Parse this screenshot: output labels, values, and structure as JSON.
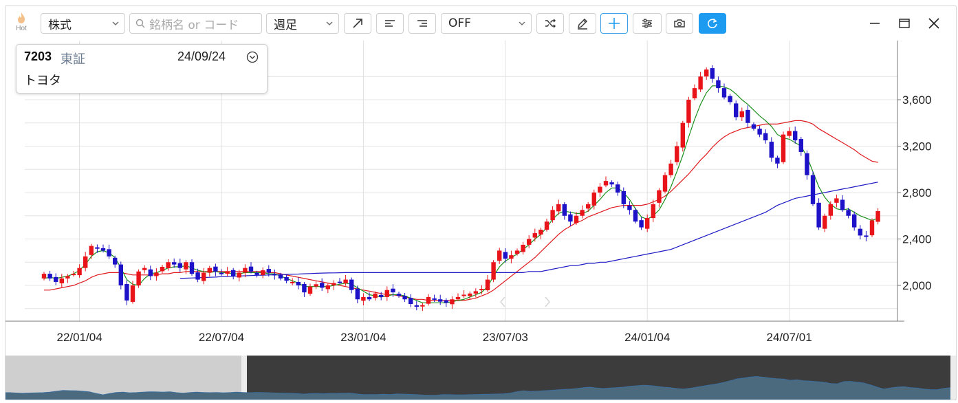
{
  "toolbar": {
    "hot_label": "Hot",
    "asset_type": "株式",
    "search_placeholder": "銘柄名 or コード",
    "period": "週足",
    "indicator": "OFF"
  },
  "info": {
    "code": "7203",
    "market": "東証",
    "date": "24/09/24",
    "name": "トヨタ"
  },
  "colors": {
    "up": "#e8141a",
    "down": "#1d12c8",
    "ma_short": "#1a8f1a",
    "ma_mid": "#e0191e",
    "ma_long": "#1b19c4",
    "accent": "#1d9bf0"
  },
  "chart_data": {
    "type": "candlestick",
    "y_ticks": [
      "2,000",
      "2,400",
      "2,800",
      "3,200",
      "3,600"
    ],
    "y_tick_values": [
      2000,
      2400,
      2800,
      3200,
      3600
    ],
    "x_ticks": [
      "22/01/04",
      "22/07/04",
      "23/01/04",
      "23/07/03",
      "24/01/04",
      "24/07/01"
    ],
    "ylim": [
      1800,
      3900
    ],
    "weeks": 142,
    "close": [
      2100,
      2060,
      2030,
      2060,
      2080,
      2100,
      2150,
      2250,
      2340,
      2320,
      2300,
      2250,
      2180,
      2000,
      1870,
      2000,
      2120,
      2150,
      2080,
      2110,
      2160,
      2200,
      2180,
      2150,
      2200,
      2100,
      2050,
      2110,
      2150,
      2120,
      2100,
      2120,
      2080,
      2110,
      2150,
      2120,
      2090,
      2130,
      2110,
      2090,
      2060,
      2040,
      2030,
      2000,
      1940,
      1990,
      2010,
      1980,
      2000,
      2020,
      2030,
      2050,
      1960,
      1880,
      1900,
      1880,
      1930,
      1900,
      1960,
      1940,
      1910,
      1880,
      1840,
      1820,
      1830,
      1900,
      1880,
      1860,
      1850,
      1880,
      1900,
      1920,
      1930,
      1950,
      1970,
      2050,
      2200,
      2300,
      2230,
      2260,
      2300,
      2350,
      2400,
      2450,
      2480,
      2550,
      2650,
      2700,
      2600,
      2550,
      2600,
      2650,
      2700,
      2800,
      2850,
      2900,
      2870,
      2800,
      2700,
      2650,
      2550,
      2500,
      2580,
      2700,
      2820,
      2950,
      3050,
      3200,
      3400,
      3600,
      3700,
      3800,
      3860,
      3780,
      3700,
      3620,
      3580,
      3450,
      3500,
      3400,
      3350,
      3300,
      3250,
      3100,
      3050,
      3300,
      3330,
      3250,
      3150,
      2950,
      2700,
      2500,
      2600,
      2700,
      2750,
      2650,
      2600,
      2500,
      2430,
      2420,
      2560,
      2640
    ],
    "ma_short": [
      2060,
      2070,
      2060,
      2070,
      2080,
      2100,
      2130,
      2180,
      2250,
      2290,
      2300,
      2280,
      2240,
      2150,
      2050,
      2010,
      2000,
      2060,
      2100,
      2110,
      2130,
      2150,
      2160,
      2160,
      2170,
      2150,
      2130,
      2120,
      2110,
      2120,
      2110,
      2110,
      2100,
      2100,
      2110,
      2110,
      2110,
      2110,
      2100,
      2100,
      2080,
      2060,
      2040,
      2020,
      1990,
      1990,
      1990,
      1990,
      1990,
      2000,
      2010,
      2020,
      2010,
      1980,
      1950,
      1920,
      1910,
      1900,
      1910,
      1920,
      1920,
      1910,
      1890,
      1870,
      1850,
      1850,
      1850,
      1850,
      1850,
      1860,
      1870,
      1880,
      1900,
      1920,
      1940,
      1990,
      2080,
      2160,
      2210,
      2240,
      2270,
      2310,
      2350,
      2400,
      2440,
      2500,
      2570,
      2620,
      2640,
      2630,
      2620,
      2620,
      2640,
      2690,
      2740,
      2800,
      2840,
      2840,
      2800,
      2740,
      2660,
      2590,
      2570,
      2600,
      2650,
      2740,
      2850,
      2980,
      3120,
      3280,
      3430,
      3560,
      3660,
      3720,
      3720,
      3710,
      3690,
      3650,
      3600,
      3560,
      3510,
      3460,
      3420,
      3370,
      3300,
      3270,
      3260,
      3230,
      3200,
      3110,
      2980,
      2850,
      2760,
      2700,
      2660,
      2650,
      2660,
      2630,
      2600,
      2580,
      2560,
      2580
    ],
    "ma_mid": [
      1960,
      1960,
      1970,
      1980,
      1990,
      2000,
      2020,
      2040,
      2070,
      2090,
      2100,
      2110,
      2110,
      2110,
      2100,
      2090,
      2090,
      2090,
      2090,
      2090,
      2100,
      2100,
      2110,
      2110,
      2120,
      2120,
      2120,
      2120,
      2120,
      2120,
      2120,
      2120,
      2120,
      2120,
      2120,
      2120,
      2120,
      2120,
      2110,
      2110,
      2100,
      2090,
      2080,
      2070,
      2060,
      2050,
      2040,
      2030,
      2020,
      2010,
      2000,
      1990,
      1980,
      1970,
      1960,
      1950,
      1940,
      1930,
      1920,
      1920,
      1910,
      1900,
      1890,
      1880,
      1880,
      1870,
      1870,
      1870,
      1870,
      1870,
      1870,
      1870,
      1880,
      1890,
      1910,
      1930,
      1960,
      2000,
      2040,
      2080,
      2120,
      2160,
      2200,
      2240,
      2290,
      2340,
      2390,
      2440,
      2480,
      2510,
      2540,
      2560,
      2590,
      2610,
      2630,
      2650,
      2670,
      2680,
      2690,
      2690,
      2690,
      2690,
      2700,
      2720,
      2740,
      2770,
      2810,
      2860,
      2910,
      2960,
      3020,
      3080,
      3130,
      3190,
      3240,
      3280,
      3310,
      3330,
      3350,
      3360,
      3370,
      3380,
      3390,
      3390,
      3390,
      3400,
      3410,
      3420,
      3420,
      3410,
      3390,
      3350,
      3320,
      3290,
      3260,
      3230,
      3200,
      3170,
      3130,
      3100,
      3070,
      3060
    ],
    "ma_long_start": 23,
    "ma_long": [
      2060,
      2062,
      2064,
      2066,
      2068,
      2070,
      2072,
      2075,
      2077,
      2079,
      2081,
      2083,
      2085,
      2087,
      2088,
      2090,
      2091,
      2093,
      2095,
      2097,
      2098,
      2100,
      2102,
      2104,
      2106,
      2107,
      2108,
      2109,
      2110,
      2110,
      2110,
      2110,
      2110,
      2110,
      2110,
      2110,
      2110,
      2110,
      2110,
      2110,
      2110,
      2110,
      2110,
      2110,
      2110,
      2110,
      2110,
      2110,
      2110,
      2110,
      2110,
      2110,
      2110,
      2110,
      2110,
      2110,
      2110,
      2110,
      2110,
      2120,
      2120,
      2120,
      2130,
      2140,
      2150,
      2160,
      2170,
      2170,
      2180,
      2190,
      2190,
      2200,
      2200,
      2210,
      2220,
      2230,
      2240,
      2250,
      2260,
      2270,
      2280,
      2290,
      2300,
      2310,
      2330,
      2350,
      2370,
      2390,
      2410,
      2430,
      2450,
      2470,
      2490,
      2510,
      2530,
      2550,
      2570,
      2590,
      2610,
      2630,
      2660,
      2690,
      2710,
      2730,
      2750,
      2760,
      2770,
      2780,
      2790,
      2800,
      2810,
      2820,
      2830,
      2840,
      2850,
      2860,
      2870,
      2880,
      2890
    ]
  }
}
